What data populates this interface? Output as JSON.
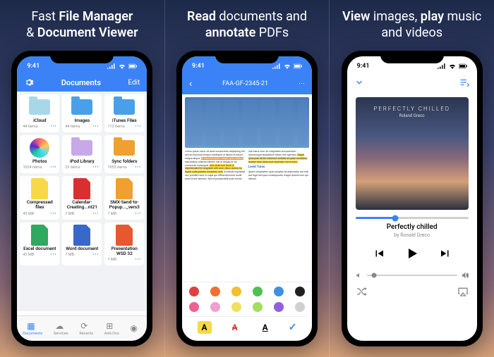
{
  "headlines": [
    {
      "pre": "Fast ",
      "b1": "File Manager",
      "mid": " & ",
      "b2": "Document Viewer"
    },
    {
      "b1": "Read",
      "mid": " documents and ",
      "b2": "annotate",
      "post": " PDFs"
    },
    {
      "pre": "",
      "b1": "View",
      "mid": " images, ",
      "b2": "play",
      "post": " music and videos"
    }
  ],
  "status_time": "9:41",
  "screen1": {
    "title": "Documents",
    "edit": "Edit",
    "tiles": [
      {
        "name": "iCloud",
        "meta": "44 items",
        "type": "folder",
        "color": "#a8d8e8",
        "icon": "cloud"
      },
      {
        "name": "Images",
        "meta": "44 items",
        "type": "folder",
        "color": "#4aa0e8",
        "icon": ""
      },
      {
        "name": "iTunes Files",
        "meta": "112 items",
        "type": "folder",
        "color": "#4aa0e8",
        "icon": ""
      },
      {
        "name": "Photos",
        "meta": "1024 items",
        "type": "icon",
        "color": "#fff",
        "icon": "photos"
      },
      {
        "name": "iPod Library",
        "meta": "23 items",
        "type": "folder",
        "color": "#c8a8e8",
        "icon": "music"
      },
      {
        "name": "Sync folders",
        "meta": "1953 items",
        "type": "folder",
        "color": "#f0a030",
        "icon": "sync"
      },
      {
        "name": "Compressed files",
        "meta": "43 MB",
        "type": "doc",
        "color": "#f8d848",
        "icon": "zip"
      },
      {
        "name": "Calendar-Creating...nt21",
        "meta": "7 MB",
        "type": "doc",
        "color": "#d83030",
        "icon": "pdf"
      },
      {
        "name": "SMX-Send-to-Popup..._vers3",
        "meta": "7 MB",
        "type": "doc",
        "color": "#f0a030",
        "icon": "pdf"
      },
      {
        "name": "Excel document",
        "meta": "43 MB",
        "type": "doc",
        "color": "#30a860",
        "icon": "xls"
      },
      {
        "name": "Word document",
        "meta": "7 MB",
        "type": "doc",
        "color": "#3868c8",
        "icon": "doc"
      },
      {
        "name": "Presentation WSD 32",
        "meta": "7 MB",
        "type": "doc",
        "color": "#e85830",
        "icon": "ppt"
      }
    ],
    "tabs": [
      {
        "label": "Documents",
        "active": true
      },
      {
        "label": "Services",
        "active": false
      },
      {
        "label": "Recents",
        "active": false
      },
      {
        "label": "Add-Ons",
        "active": false
      },
      {
        "label": "",
        "active": false
      }
    ]
  },
  "screen2": {
    "doc_title": "FAA-GF-2345-21",
    "back": "‹",
    "menu": "⋯",
    "heading1": "Level Turns",
    "colors": [
      "#e04040",
      "#f07030",
      "#f0c030",
      "#50c050",
      "#4090e0",
      "#202020",
      "#f06090",
      "#f0a0d0",
      "#f0e060",
      "#a0e060",
      "#9060e0",
      "#d0d0d0"
    ],
    "check": "✓",
    "styles": [
      {
        "bg": "#f8d848",
        "color": "#000",
        "txt": "A"
      },
      {
        "bg": "",
        "color": "#d83030",
        "txt": "A",
        "strike": true
      },
      {
        "bg": "",
        "color": "#000",
        "txt": "A",
        "underline": true
      }
    ]
  },
  "screen3": {
    "album_caption": "PERFECTLY CHILLED",
    "album_artist": "Roland Greco",
    "track": "Perfectly chilled",
    "artist": "by Ronald Greco"
  }
}
